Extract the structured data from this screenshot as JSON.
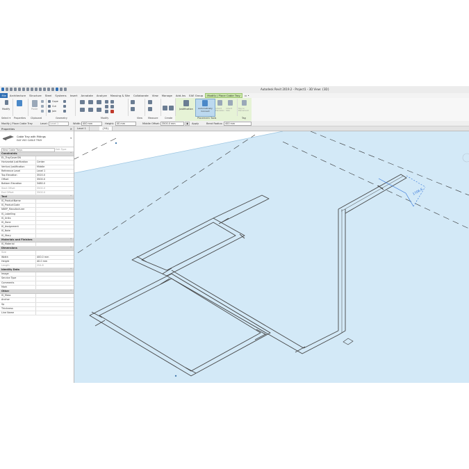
{
  "app": {
    "title": "Autodesk Revit 2019.2 - Project1 - 3D View: {3D}"
  },
  "tabs": [
    {
      "label": "File",
      "style": "file"
    },
    {
      "label": "Architecture"
    },
    {
      "label": "Structure"
    },
    {
      "label": "Steel"
    },
    {
      "label": "Systems"
    },
    {
      "label": "Insert"
    },
    {
      "label": "Annotate"
    },
    {
      "label": "Analyze"
    },
    {
      "label": "Massing & Site"
    },
    {
      "label": "Collaborate"
    },
    {
      "label": "View"
    },
    {
      "label": "Manage"
    },
    {
      "label": "Add-Ins"
    },
    {
      "label": "EAE Group"
    },
    {
      "label": "Modify | Place Cable Tray",
      "style": "ctx"
    },
    {
      "label": "▭ •"
    }
  ],
  "ribbon": {
    "modify_label": "Modify",
    "select_label": "Select ▾",
    "properties_label": "Properties",
    "paste_label": "Paste",
    "clipboard_label": "Clipboard",
    "cope_label": "Cope",
    "cut_label": "Cut",
    "join_label": "Join",
    "geometry_label": "Geometry",
    "modify_panel_label": "Modify",
    "view_label": "View",
    "measure_label": "Measure",
    "create_label": "Create",
    "justification_label": "Justification",
    "auto_connect_label": "Automatically Connect",
    "inherit_elev_label": "Inherit Elevation",
    "inherit_size_label": "Inherit Size",
    "tag_on_placement_label": "Tag on Placement",
    "placement_tools_label": "Placement Tools",
    "tag_label": "Tag"
  },
  "options_bar": {
    "context": "Modify | Place Cable Tray",
    "level_label": "Level:",
    "level_value": "Level 1",
    "width_label": "Width:",
    "width_value": "400 mm",
    "height_label": "Height:",
    "height_value": "40 mm",
    "offset_label": "Middle Offset:",
    "offset_value": "3500.0 mm",
    "apply_label": "Apply",
    "bend_label": "Bend Radius:",
    "bend_value": "400 mm"
  },
  "properties": {
    "title": "Properties",
    "close": "×",
    "type_family": "Cable Tray with Fittings",
    "type_name": "EAE VKO CABLE TRAY",
    "instance_selector": "New Cable Trays",
    "edit_type": "Edit Type",
    "groups": [
      {
        "name": "Constraints",
        "rows": [
          {
            "k": "EL_TrayCoverON",
            "v": ""
          },
          {
            "k": "Horizontal Justification",
            "v": "Center"
          },
          {
            "k": "Vertical Justification",
            "v": "Middle"
          },
          {
            "k": "Reference Level",
            "v": "Level 1"
          },
          {
            "k": "Top Elevation",
            "v": "3520.0"
          },
          {
            "k": "Offset",
            "v": "3500.0"
          },
          {
            "k": "Bottom Elevation",
            "v": "3480.0"
          },
          {
            "k": "Start Offset",
            "v": "3500.0",
            "dim": true
          },
          {
            "k": "End Offset",
            "v": "3500.0",
            "dim": true
          }
        ]
      },
      {
        "name": "Text",
        "rows": [
          {
            "k": "IS_ProductName",
            "v": ""
          },
          {
            "k": "IS_ProductCode",
            "v": ""
          },
          {
            "k": "NBEP_Manufacturer",
            "v": ""
          },
          {
            "k": "IS_Labelling",
            "v": ""
          },
          {
            "k": "IS_Units",
            "v": ""
          },
          {
            "k": "IS_Zone",
            "v": ""
          },
          {
            "k": "IS_Assignment",
            "v": ""
          },
          {
            "k": "IS_Note",
            "v": ""
          },
          {
            "k": "IS_Story",
            "v": ""
          }
        ]
      },
      {
        "name": "Materials and Finishes",
        "rows": [
          {
            "k": "IS_Material",
            "v": ""
          }
        ]
      },
      {
        "name": "Dimensions",
        "rows": [
          {
            "k": "Size",
            "v": "",
            "dim": true
          },
          {
            "k": "Width",
            "v": "400.0 mm"
          },
          {
            "k": "Height",
            "v": "40.0 mm"
          },
          {
            "k": "Length",
            "v": "254.8",
            "dim": true
          }
        ]
      },
      {
        "name": "Identity Data",
        "rows": [
          {
            "k": "Image",
            "v": ""
          },
          {
            "k": "Service Type",
            "v": ""
          },
          {
            "k": "Comments",
            "v": ""
          },
          {
            "k": "Mark",
            "v": ""
          }
        ]
      },
      {
        "name": "Other",
        "rows": [
          {
            "k": "IS_Mass",
            "v": ""
          },
          {
            "k": "Anchor",
            "v": ""
          },
          {
            "k": "Sp",
            "v": ""
          },
          {
            "k": "Thickness",
            "v": ""
          },
          {
            "k": "Line Name",
            "v": ""
          }
        ]
      }
    ]
  },
  "view_tabs": [
    {
      "label": "Level 1",
      "active": false
    },
    {
      "label": "{3D}",
      "active": true
    }
  ],
  "dimension": {
    "value": "1706.6"
  },
  "colors": {
    "accent": "#2f6fb5",
    "context_tab": "#c9e6a8",
    "plane": "#d2e8f6",
    "plane_edge": "#7fb4d8",
    "tray": "#444444",
    "dimension": "#2a6ed8"
  }
}
